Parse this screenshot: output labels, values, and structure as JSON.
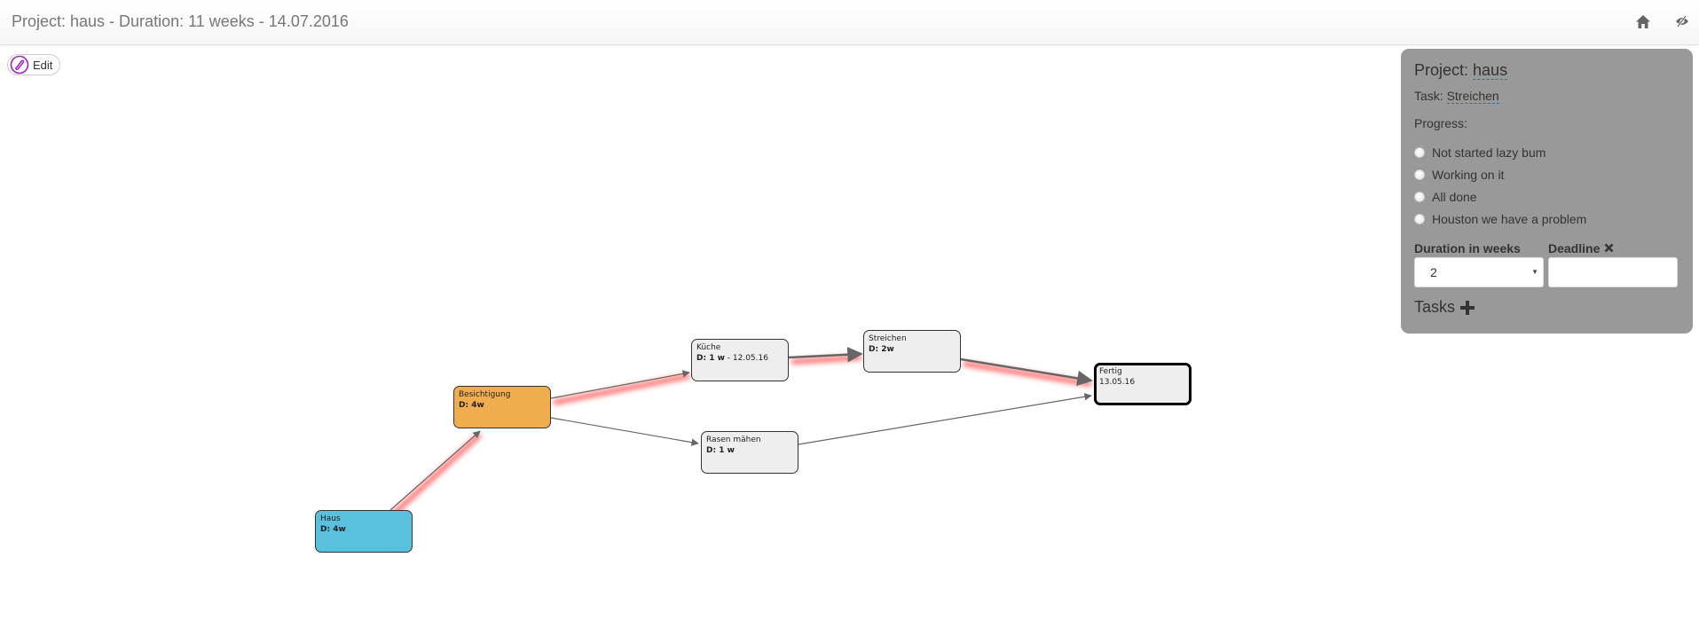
{
  "header": {
    "title": "Project: haus - Duration: 11 weeks - 14.07.2016",
    "icons": [
      "home-icon",
      "eye-slash-icon"
    ]
  },
  "toolbar": {
    "edit_label": "Edit",
    "edit_icon": "pencil-icon"
  },
  "graph": {
    "colors": {
      "start": "#5bc0de",
      "active": "#f0ad4e",
      "default": "#eeeeee",
      "edge": "#666666",
      "critical_glow": "#ff0000"
    },
    "nodes": [
      {
        "id": "haus",
        "label": "Haus",
        "meta_bold": "D: 4w",
        "meta_extra": "",
        "kind": "start"
      },
      {
        "id": "besichtigung",
        "label": "Besichtigung",
        "meta_bold": "D: 4w",
        "meta_extra": "",
        "kind": "active"
      },
      {
        "id": "kueche",
        "label": "Küche",
        "meta_bold": "D: 1 w",
        "meta_extra": " - 12.05.16",
        "kind": "default"
      },
      {
        "id": "streichen",
        "label": "Streichen",
        "meta_bold": "D: 2w",
        "meta_extra": "",
        "kind": "default"
      },
      {
        "id": "rasen",
        "label": "Rasen mähen",
        "meta_bold": "D: 1 w",
        "meta_extra": "",
        "kind": "default"
      },
      {
        "id": "fertig",
        "label": "Fertig",
        "meta_bold": "",
        "meta_extra": "13.05.16",
        "kind": "end"
      }
    ],
    "edges": [
      {
        "from": "haus",
        "to": "besichtigung",
        "critical": true
      },
      {
        "from": "besichtigung",
        "to": "kueche",
        "critical": true
      },
      {
        "from": "besichtigung",
        "to": "rasen",
        "critical": false
      },
      {
        "from": "kueche",
        "to": "streichen",
        "critical": true
      },
      {
        "from": "streichen",
        "to": "fertig",
        "critical": true
      },
      {
        "from": "rasen",
        "to": "fertig",
        "critical": false
      }
    ]
  },
  "panel": {
    "project_label": "Project: ",
    "project_name": "haus",
    "task_label": "Task: ",
    "task_name": "Streichen",
    "progress_label": "Progress:",
    "progress_options": [
      "Not started lazy bum",
      "Working on it",
      "All done",
      "Houston we have a problem"
    ],
    "progress_selected": null,
    "duration_label": "Duration in weeks",
    "duration_value": "2",
    "deadline_label": "Deadline",
    "deadline_value": "",
    "tasks_label": "Tasks"
  }
}
